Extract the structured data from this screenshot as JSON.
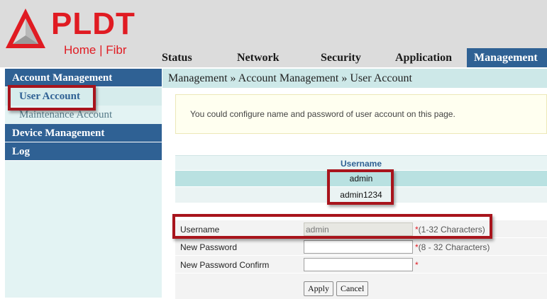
{
  "brand": {
    "name": "PLDT",
    "subtitle": "Home | Fibr",
    "color": "#e01b22"
  },
  "tabs": [
    {
      "label": "Status",
      "active": false
    },
    {
      "label": "Network",
      "active": false
    },
    {
      "label": "Security",
      "active": false
    },
    {
      "label": "Application",
      "active": false
    },
    {
      "label": "Management",
      "active": true
    }
  ],
  "sidebar": {
    "sections": [
      {
        "title": "Account Management",
        "items": [
          {
            "label": "User Account",
            "current": true
          },
          {
            "label": "Maintenance Account",
            "current": false
          }
        ]
      },
      {
        "title": "Device Management",
        "items": []
      },
      {
        "title": "Log",
        "items": []
      }
    ]
  },
  "breadcrumb": "Management » Account Management » User Account",
  "info_text": "You could configure name and password of user account on this page.",
  "user_table": {
    "header": "Username",
    "rows": [
      "admin",
      "admin1234"
    ]
  },
  "form": {
    "username": {
      "label": "Username",
      "value": "admin",
      "required": "*",
      "hint": "(1-32 Characters)"
    },
    "new_password": {
      "label": "New Password",
      "value": "",
      "required": "*",
      "hint": "(8 - 32 Characters)"
    },
    "confirm": {
      "label": "New Password Confirm",
      "value": "",
      "required": "*",
      "hint": ""
    }
  },
  "buttons": {
    "apply": "Apply",
    "cancel": "Cancel"
  },
  "colors": {
    "nav_blue": "#2f6194",
    "highlight_red": "#a8141c"
  }
}
